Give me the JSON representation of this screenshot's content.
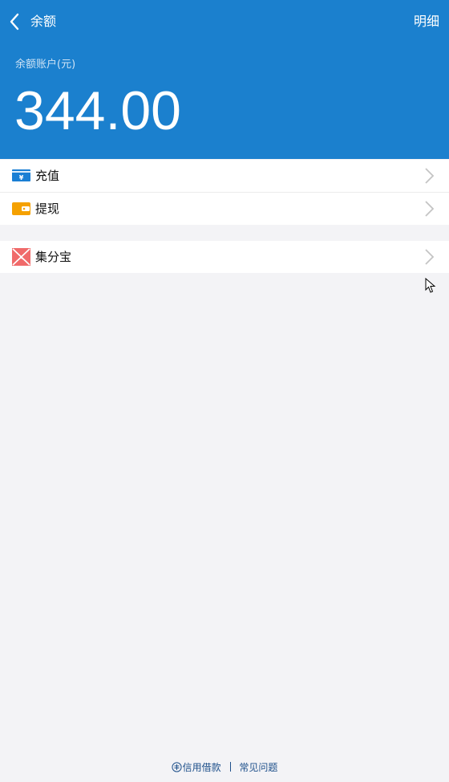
{
  "header": {
    "title": "余额",
    "detail_link": "明细",
    "balance_label": "余额账户(元)",
    "balance_amount": "344.00",
    "background_color": "#1b80ce"
  },
  "menu_group_1": [
    {
      "label": "充值",
      "icon": "recharge-card-icon",
      "icon_color": "#1a7fd4"
    },
    {
      "label": "提现",
      "icon": "wallet-icon",
      "icon_color": "#f5a100"
    }
  ],
  "menu_group_2": [
    {
      "label": "集分宝",
      "icon": "jifenbao-icon",
      "icon_color": "#f06a6a"
    }
  ],
  "footer": {
    "credit_loan": "信用借款",
    "faq": "常见问题",
    "credit_icon": "credit-badge-icon"
  }
}
